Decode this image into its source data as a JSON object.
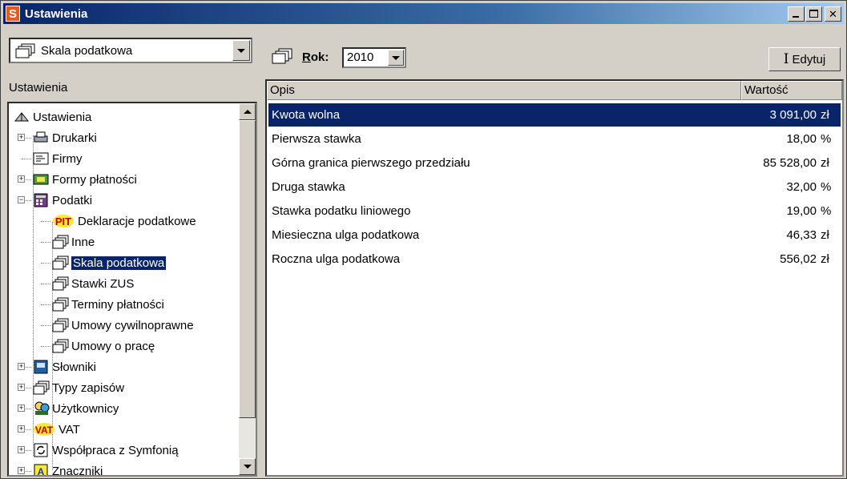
{
  "window": {
    "title": "Ustawienia",
    "app_letter": "S"
  },
  "left_panel": {
    "combo_value": "Skala podatkowa",
    "header": "Ustawienia",
    "tree": [
      {
        "label": "Ustawienia",
        "icon": "network-icon",
        "level": 0,
        "expander": "",
        "selected": false
      },
      {
        "label": "Drukarki",
        "icon": "printer-icon",
        "level": 1,
        "expander": "+",
        "selected": false
      },
      {
        "label": "Firmy",
        "icon": "company-card-icon",
        "level": 1,
        "expander": "",
        "selected": false
      },
      {
        "label": "Formy płatności",
        "icon": "payment-icon",
        "level": 1,
        "expander": "+",
        "selected": false
      },
      {
        "label": "Podatki",
        "icon": "calculator-icon",
        "level": 1,
        "expander": "-",
        "selected": false
      },
      {
        "label": "Deklaracje podatkowe",
        "icon": "pit-icon",
        "level": 2,
        "expander": "",
        "selected": false
      },
      {
        "label": "Inne",
        "icon": "folder-stack-icon",
        "level": 2,
        "expander": "",
        "selected": false
      },
      {
        "label": "Skala podatkowa",
        "icon": "folder-stack-icon",
        "level": 2,
        "expander": "",
        "selected": true
      },
      {
        "label": "Stawki ZUS",
        "icon": "folder-stack-icon",
        "level": 2,
        "expander": "",
        "selected": false
      },
      {
        "label": "Terminy płatności",
        "icon": "folder-stack-icon",
        "level": 2,
        "expander": "",
        "selected": false
      },
      {
        "label": "Umowy cywilnoprawne",
        "icon": "folder-stack-icon",
        "level": 2,
        "expander": "",
        "selected": false
      },
      {
        "label": "Umowy o pracę",
        "icon": "folder-stack-icon",
        "level": 2,
        "expander": "",
        "selected": false
      },
      {
        "label": "Słowniki",
        "icon": "dictionary-icon",
        "level": 1,
        "expander": "+",
        "selected": false
      },
      {
        "label": "Typy zapisów",
        "icon": "folder-stack-icon",
        "level": 1,
        "expander": "+",
        "selected": false
      },
      {
        "label": "Użytkownicy",
        "icon": "users-icon",
        "level": 1,
        "expander": "+",
        "selected": false
      },
      {
        "label": "VAT",
        "icon": "vat-icon",
        "level": 1,
        "expander": "+",
        "selected": false
      },
      {
        "label": "Współpraca z Symfonią",
        "icon": "sync-icon",
        "level": 1,
        "expander": "+",
        "selected": false
      },
      {
        "label": "Znaczniki",
        "icon": "marker-icon",
        "level": 1,
        "expander": "+",
        "selected": false
      }
    ]
  },
  "toolbar": {
    "year_label_first": "R",
    "year_label_rest": "ok:",
    "year_value": "2010",
    "edit_label": "Edytuj"
  },
  "grid": {
    "columns": [
      "Opis",
      "Wartość"
    ],
    "rows": [
      {
        "name": "Kwota wolna",
        "value": "3 091,00",
        "unit": "zł",
        "selected": true
      },
      {
        "name": "Pierwsza stawka",
        "value": "18,00",
        "unit": "%",
        "selected": false
      },
      {
        "name": "Górna granica pierwszego przedziału",
        "value": "85 528,00",
        "unit": "zł",
        "selected": false
      },
      {
        "name": "Druga stawka",
        "value": "32,00",
        "unit": "%",
        "selected": false
      },
      {
        "name": "Stawka podatku liniowego",
        "value": "19,00",
        "unit": "%",
        "selected": false
      },
      {
        "name": "Miesieczna ulga podatkowa",
        "value": "46,33",
        "unit": "zł",
        "selected": false
      },
      {
        "name": "Roczna ulga podatkowa",
        "value": "556,02",
        "unit": "zł",
        "selected": false
      }
    ]
  },
  "colors": {
    "selection": "#0a246a",
    "chrome": "#d4d0c8",
    "app_icon": "#e65c1e"
  }
}
